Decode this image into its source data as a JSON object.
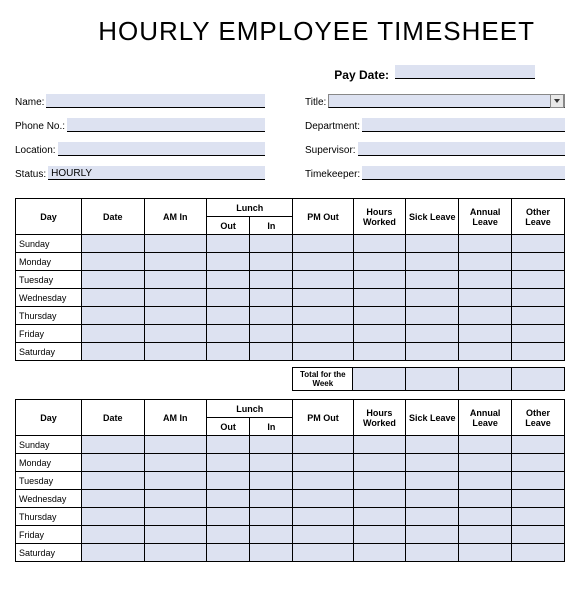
{
  "title": "HOURLY EMPLOYEE TIMESHEET",
  "pay_date": {
    "label": "Pay Date:",
    "value": ""
  },
  "left_fields": {
    "name": {
      "label": "Name:",
      "value": ""
    },
    "phone": {
      "label": "Phone No.:",
      "value": ""
    },
    "location": {
      "label": "Location:",
      "value": ""
    },
    "status": {
      "label": "Status:",
      "value": "HOURLY"
    }
  },
  "right_fields": {
    "title": {
      "label": "Title:",
      "value": ""
    },
    "department": {
      "label": "Department:",
      "value": ""
    },
    "supervisor": {
      "label": "Supervisor:",
      "value": ""
    },
    "timekeeper": {
      "label": "Timekeeper:",
      "value": ""
    }
  },
  "table_headers": {
    "day": "Day",
    "date": "Date",
    "am_in": "AM In",
    "lunch": "Lunch",
    "lunch_out": "Out",
    "lunch_in": "In",
    "pm_out": "PM Out",
    "hours_worked": "Hours Worked",
    "sick_leave": "Sick Leave",
    "annual_leave": "Annual Leave",
    "other_leave": "Other Leave"
  },
  "days": [
    "Sunday",
    "Monday",
    "Tuesday",
    "Wednesday",
    "Thursday",
    "Friday",
    "Saturday"
  ],
  "total_label": "Total for the Week"
}
